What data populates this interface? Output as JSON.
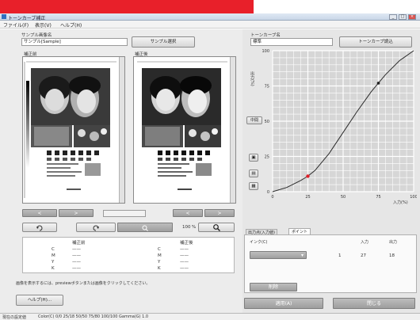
{
  "window": {
    "title": "トーンカーブ補正",
    "controls": [
      "_",
      "□",
      "×"
    ]
  },
  "menu": {
    "items": [
      "ファイル(F)",
      "表示(V)",
      "ヘルプ(H)"
    ]
  },
  "sample": {
    "label": "サンプル画像名",
    "value": "サンプル[Sample]",
    "button": "サンプル選択"
  },
  "tone": {
    "label": "トーンカーブ名",
    "value": "標準",
    "button": "トーンカーブ読込"
  },
  "preview": {
    "before_label": "補正前",
    "after_label": "補正後"
  },
  "graph": {
    "y_label": "出力(%)",
    "x_label": "入力(%)",
    "y_ticks": [
      "100",
      "75",
      "50",
      "25",
      "0"
    ],
    "x_ticks": [
      "0",
      "25",
      "50",
      "75",
      "100"
    ],
    "mid_button": "中間",
    "side_icons": [
      "edit-icon",
      "copy-icon",
      "grid-icon"
    ]
  },
  "nav": {
    "left_prev": "<",
    "left_next": ">",
    "right_prev": "<",
    "right_next": ">",
    "zoom_value": "100",
    "zoom_unit": "%"
  },
  "info_table": {
    "left_header": "補正前",
    "right_header": "補正後",
    "rows": [
      {
        "key": "C",
        "before": "——",
        "after": "——"
      },
      {
        "key": "M",
        "before": "——",
        "after": "——"
      },
      {
        "key": "Y",
        "before": "——",
        "after": "——"
      },
      {
        "key": "K",
        "before": "——",
        "after": "——"
      }
    ]
  },
  "note": "画像を表示するには、previewボタンまたは画像をクリックしてください。",
  "help_button": "ヘルプ(H)...",
  "tabs": [
    "出力点(入力値)",
    "ポイント"
  ],
  "point_panel": {
    "color_label": "インク(C)",
    "input_header": "入力",
    "output_header": "出力",
    "row_index": "1",
    "input_value": "27",
    "output_value": "18",
    "select_value": "",
    "delete_button": "削除"
  },
  "bottom_buttons": {
    "apply": "適用(A)",
    "cancel": "閉じる"
  },
  "status": {
    "label": "現在の設定値",
    "text": "Color(C) 0/0 25/18 50/50 75/80 100/100 Gamma(G) 1.0"
  },
  "colors": {
    "accent_red": "#e8202a",
    "curve": "#2a2a2a",
    "point_red": "#e0202a"
  },
  "chart_data": {
    "type": "line",
    "x": [
      0,
      10,
      20,
      25,
      30,
      40,
      50,
      60,
      70,
      75,
      80,
      90,
      100
    ],
    "series": [
      {
        "values": [
          0,
          3,
          8,
          11,
          15,
          27,
          42,
          57,
          71,
          77,
          83,
          93,
          100
        ]
      }
    ],
    "control_points": [
      {
        "x": 25,
        "y": 11
      },
      {
        "x": 75,
        "y": 77
      }
    ],
    "xlim": [
      0,
      100
    ],
    "ylim": [
      0,
      100
    ]
  }
}
